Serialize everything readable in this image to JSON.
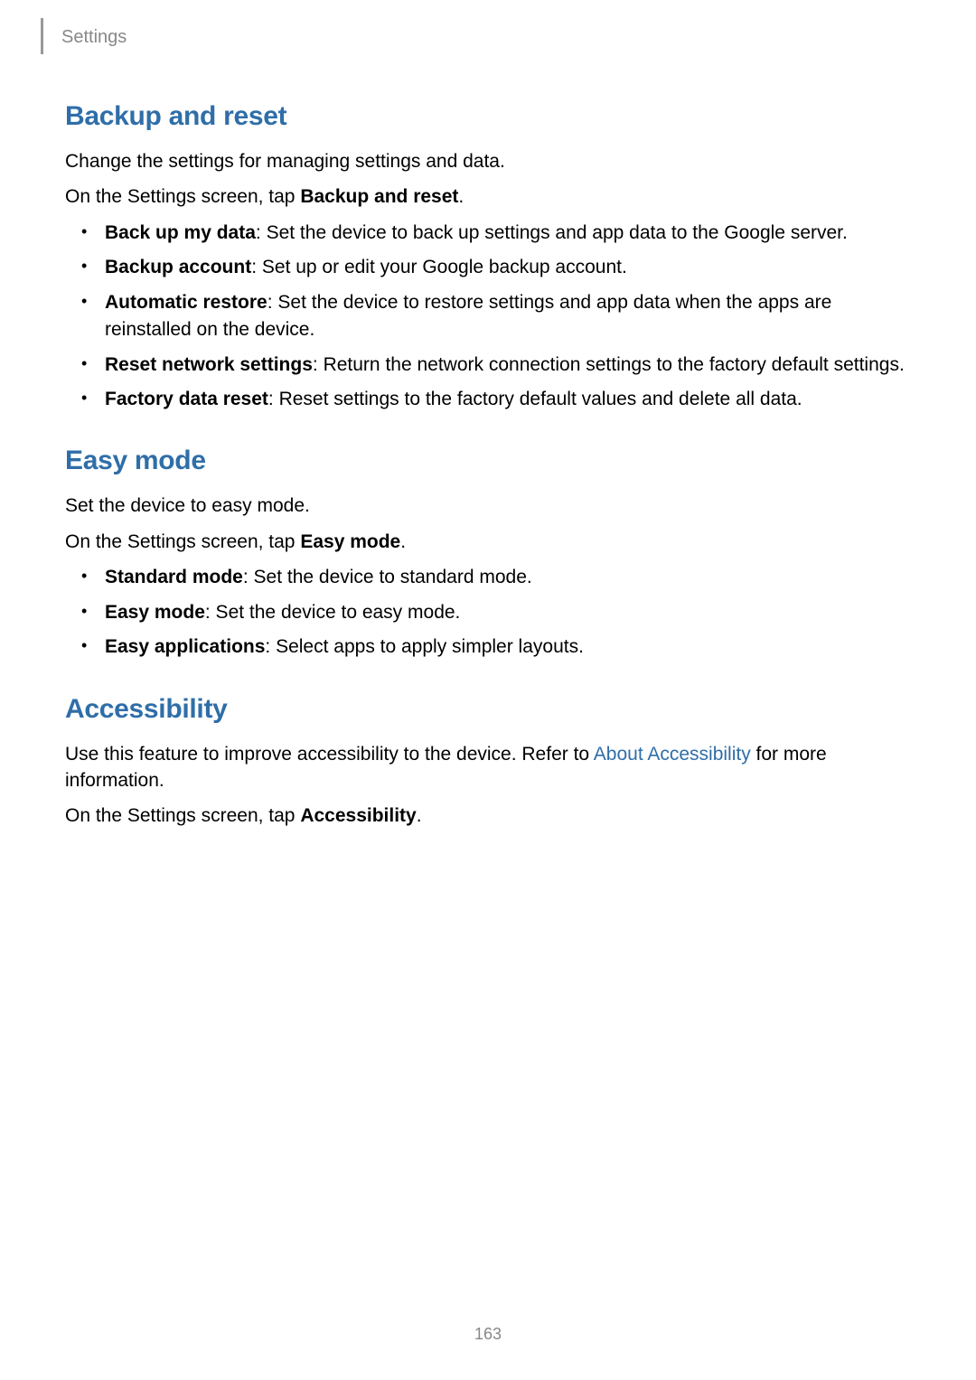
{
  "header": {
    "label": "Settings"
  },
  "sections": {
    "backup": {
      "heading": "Backup and reset",
      "intro": "Change the settings for managing settings and data.",
      "instruction_prefix": "On the Settings screen, tap ",
      "instruction_bold": "Backup and reset",
      "instruction_suffix": ".",
      "items": {
        "i0": {
          "bold": "Back up my data",
          "rest": ": Set the device to back up settings and app data to the Google server."
        },
        "i1": {
          "bold": "Backup account",
          "rest": ": Set up or edit your Google backup account."
        },
        "i2": {
          "bold": "Automatic restore",
          "rest": ": Set the device to restore settings and app data when the apps are reinstalled on the device."
        },
        "i3": {
          "bold": "Reset network settings",
          "rest": ": Return the network connection settings to the factory default settings."
        },
        "i4": {
          "bold": "Factory data reset",
          "rest": ": Reset settings to the factory default values and delete all data."
        }
      }
    },
    "easy": {
      "heading": "Easy mode",
      "intro": "Set the device to easy mode.",
      "instruction_prefix": "On the Settings screen, tap ",
      "instruction_bold": "Easy mode",
      "instruction_suffix": ".",
      "items": {
        "i0": {
          "bold": "Standard mode",
          "rest": ": Set the device to standard mode."
        },
        "i1": {
          "bold": "Easy mode",
          "rest": ": Set the device to easy mode."
        },
        "i2": {
          "bold": "Easy applications",
          "rest": ": Select apps to apply simpler layouts."
        }
      }
    },
    "accessibility": {
      "heading": "Accessibility",
      "intro_prefix": "Use this feature to improve accessibility to the device. Refer to ",
      "intro_link": "About Accessibility",
      "intro_suffix": " for more information.",
      "instruction_prefix": "On the Settings screen, tap ",
      "instruction_bold": "Accessibility",
      "instruction_suffix": "."
    }
  },
  "page_number": "163"
}
